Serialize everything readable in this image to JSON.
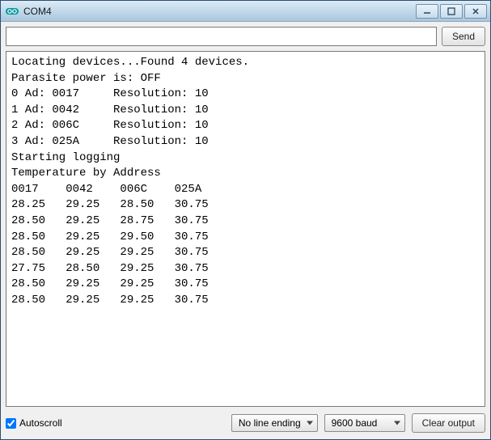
{
  "window": {
    "title": "COM4"
  },
  "input": {
    "value": "",
    "placeholder": ""
  },
  "buttons": {
    "send": "Send",
    "clear_output": "Clear output"
  },
  "autoscroll": {
    "label": "Autoscroll",
    "checked": true
  },
  "line_ending": {
    "selected": "No line ending"
  },
  "baud": {
    "selected": "9600 baud"
  },
  "console": {
    "header_lines": [
      "Locating devices...Found 4 devices.",
      "Parasite power is: OFF"
    ],
    "devices": [
      {
        "index": 0,
        "address": "0017",
        "resolution": 10
      },
      {
        "index": 1,
        "address": "0042",
        "resolution": 10
      },
      {
        "index": 2,
        "address": "006C",
        "resolution": 10
      },
      {
        "index": 3,
        "address": "025A",
        "resolution": 10
      }
    ],
    "logging_line": "Starting logging",
    "temp_header": "Temperature by Address",
    "temp_columns": [
      "0017",
      "0042",
      "006C",
      "025A"
    ],
    "temp_rows": [
      [
        28.25,
        29.25,
        28.5,
        30.75
      ],
      [
        28.5,
        29.25,
        28.75,
        30.75
      ],
      [
        28.5,
        29.25,
        29.5,
        30.75
      ],
      [
        28.5,
        29.25,
        29.25,
        30.75
      ],
      [
        27.75,
        28.5,
        29.25,
        30.75
      ],
      [
        28.5,
        29.25,
        29.25,
        30.75
      ],
      [
        28.5,
        29.25,
        29.25,
        30.75
      ]
    ]
  }
}
